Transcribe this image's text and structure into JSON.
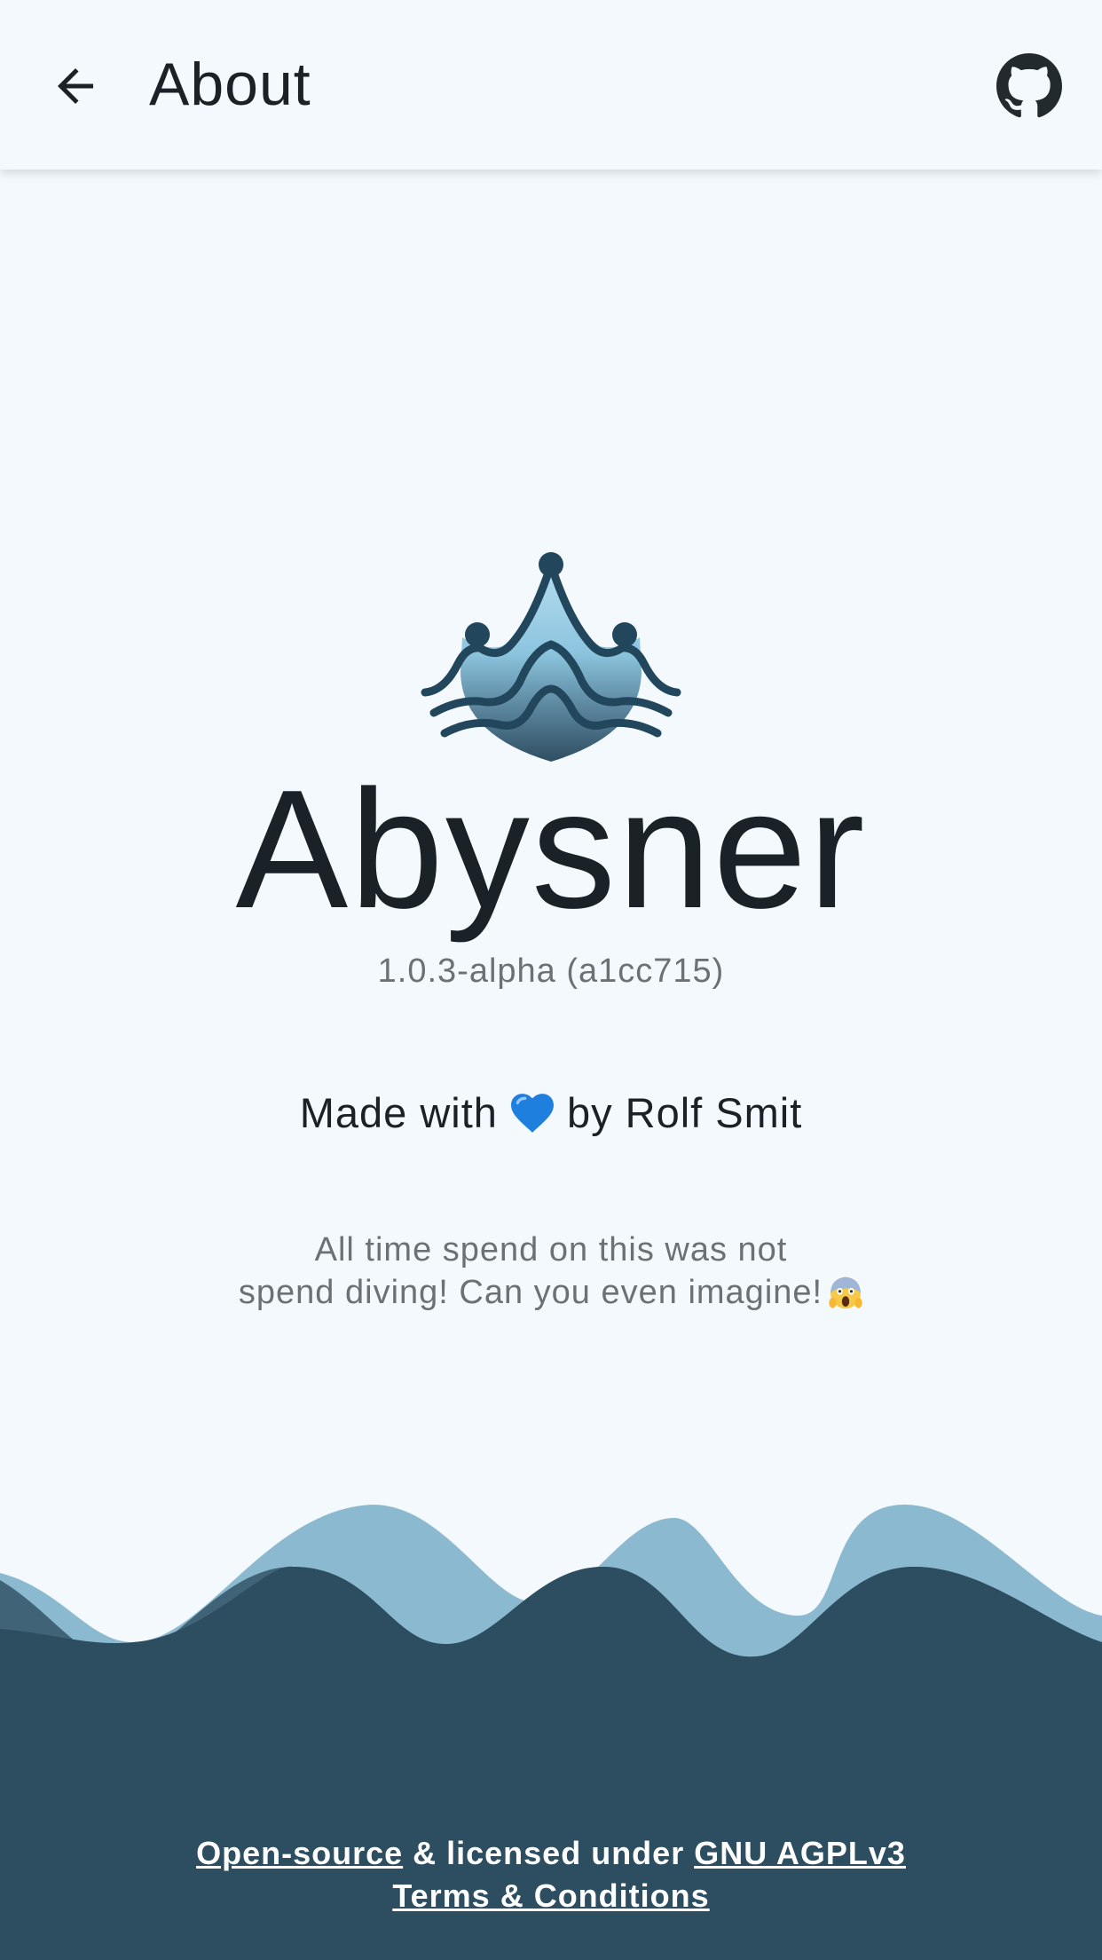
{
  "appbar": {
    "title": "About",
    "back_icon": "arrow-left-icon",
    "github_icon": "github-icon"
  },
  "app": {
    "name": "Abysner",
    "version": "1.0.3-alpha (a1cc715)",
    "logo_icon": "abysner-logo-icon"
  },
  "credits": {
    "made_with_prefix": "Made with",
    "heart_icon": "blue-heart-icon",
    "made_with_suffix": "by Rolf Smit"
  },
  "tagline": {
    "line1": "All time spend on this was not",
    "line2": "spend diving! Can you even imagine!",
    "emoji_icon": "screaming-face-icon"
  },
  "footer": {
    "open_source_link": "Open-source",
    "licensed_text": " & licensed under ",
    "license_link": "GNU AGPLv3",
    "terms_link": "Terms & Conditions"
  },
  "colors": {
    "background": "#f3f9fc",
    "wave_light": "#8bb9cf",
    "wave_dark": "#2d4d61",
    "text_primary": "#1b2227",
    "text_secondary": "#6c7174"
  }
}
